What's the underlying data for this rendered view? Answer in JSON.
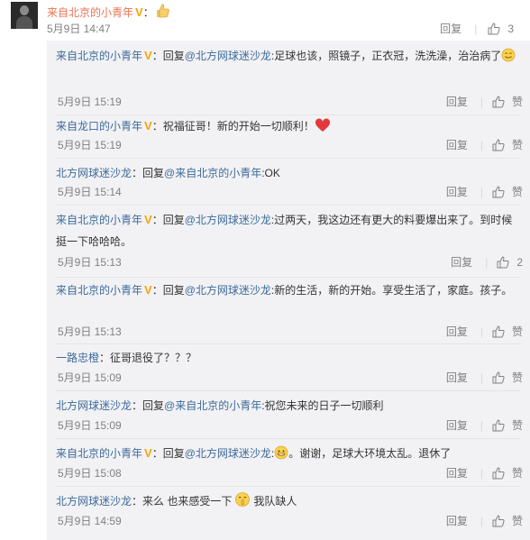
{
  "top": {
    "username": "来自北京的小青年",
    "verified": "V",
    "separator": "：",
    "time": "5月9日 14:47",
    "reply": "回复",
    "like_count": "3"
  },
  "replies": [
    {
      "user": "来自北京的小青年",
      "verified": true,
      "text_prefix": "：回复",
      "mention": "@北方网球迷沙龙",
      "text": ":足球也该，照镜子，正衣冠，洗洗澡，治治病了",
      "emoji": "smile",
      "time": "5月9日 15:19",
      "reply": "回复",
      "like": "赞"
    },
    {
      "user": "来自龙口的小青年",
      "verified": true,
      "text_prefix": "：祝福征哥！新的开始一切顺利！",
      "mention": "",
      "text": "",
      "emoji": "heart",
      "time": "5月9日 15:19",
      "reply": "回复",
      "like": "赞"
    },
    {
      "user": "北方网球迷沙龙",
      "verified": false,
      "text_prefix": "：回复",
      "mention": "@来自北京的小青年",
      "text": ":OK",
      "emoji": "",
      "time": "5月9日 15:14",
      "reply": "回复",
      "like": "赞"
    },
    {
      "user": "来自北京的小青年",
      "verified": true,
      "text_prefix": "：回复",
      "mention": "@北方网球迷沙龙",
      "text": ":过两天，我这边还有更大的料要爆出来了。到时候挺一下哈哈哈。",
      "emoji": "",
      "time": "5月9日 15:13",
      "reply": "回复",
      "like": "2"
    },
    {
      "user": "来自北京的小青年",
      "verified": true,
      "text_prefix": "：回复",
      "mention": "@北方网球迷沙龙",
      "text": ":新的生活，新的开始。享受生活了，家庭。孩子。",
      "emoji": "",
      "time": "5月9日 15:13",
      "reply": "回复",
      "like": "赞"
    },
    {
      "user": "一路忠橙",
      "verified": false,
      "text_prefix": "：征哥退役了？？？",
      "mention": "",
      "text": "",
      "emoji": "",
      "time": "5月9日 15:09",
      "reply": "回复",
      "like": "赞"
    },
    {
      "user": "北方网球迷沙龙",
      "verified": false,
      "text_prefix": "：回复",
      "mention": "@来自北京的小青年",
      "text": ":祝您未来的日子一切顺利",
      "emoji": "",
      "time": "5月9日 15:09",
      "reply": "回复",
      "like": "赞"
    },
    {
      "user": "来自北京的小青年",
      "verified": true,
      "text_prefix": "：回复",
      "mention": "@北方网球迷沙龙",
      "text": ":",
      "emoji": "grin",
      "text_after": "。谢谢，足球大环境太乱。退休了",
      "time": "5月9日 15:08",
      "reply": "回复",
      "like": "赞"
    },
    {
      "user": "北方网球迷沙龙",
      "verified": false,
      "text_prefix": "：来么 也来感受一下",
      "mention": "",
      "text": "",
      "emoji": "shush",
      "text_after": "我队缺人",
      "time": "5月9日 14:59",
      "reply": "回复",
      "like": "赞"
    }
  ],
  "colors": {
    "username": "#eb7350",
    "link": "#3e6a99",
    "meta": "#808080",
    "panel": "#f2f2f5"
  }
}
